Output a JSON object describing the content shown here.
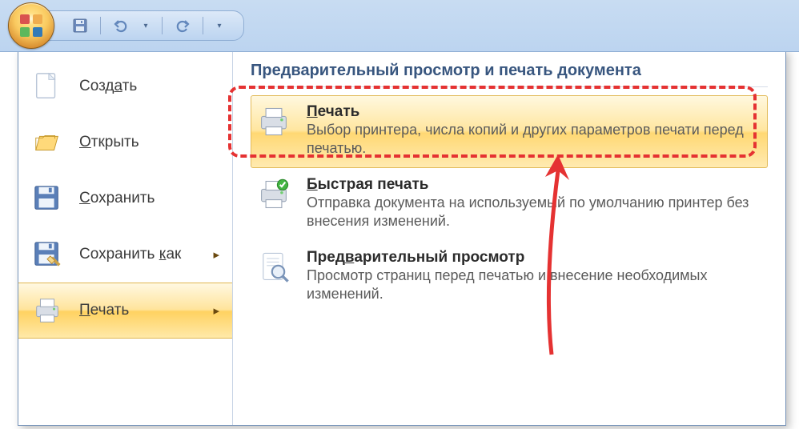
{
  "titlebar": {
    "qat": {
      "save": "Сохранить",
      "undo": "Отменить",
      "redo": "Повторить"
    }
  },
  "menu_left": {
    "items": [
      {
        "label_html": "Созд<u>а</u>ть",
        "icon": "new"
      },
      {
        "label_html": "<u>О</u>ткрыть",
        "icon": "open"
      },
      {
        "label_html": "<u>С</u>охранить",
        "icon": "save"
      },
      {
        "label_html": "Сохранить <u>к</u>ак",
        "icon": "saveas",
        "arrow": true
      },
      {
        "label_html": "<u>П</u>ечать",
        "icon": "print",
        "arrow": true,
        "active": true
      }
    ]
  },
  "panel": {
    "title": "Предварительный просмотр и печать документа",
    "options": [
      {
        "title_html": "<u>П</u>ечать",
        "desc": "Выбор принтера, числа копий и других параметров печати перед печатью.",
        "icon": "printer",
        "hover": true,
        "name": "opt-print"
      },
      {
        "title_html": "<u>Б</u>ыстрая печать",
        "desc": "Отправка документа на используемый по умолчанию принтер без внесения изменений.",
        "icon": "printer-quick",
        "name": "opt-quick-print"
      },
      {
        "title_html": "Пред<u>в</u>арительный просмотр",
        "desc": "Просмотр страниц перед печатью и внесение необходимых изменений.",
        "icon": "preview",
        "name": "opt-print-preview"
      }
    ]
  }
}
